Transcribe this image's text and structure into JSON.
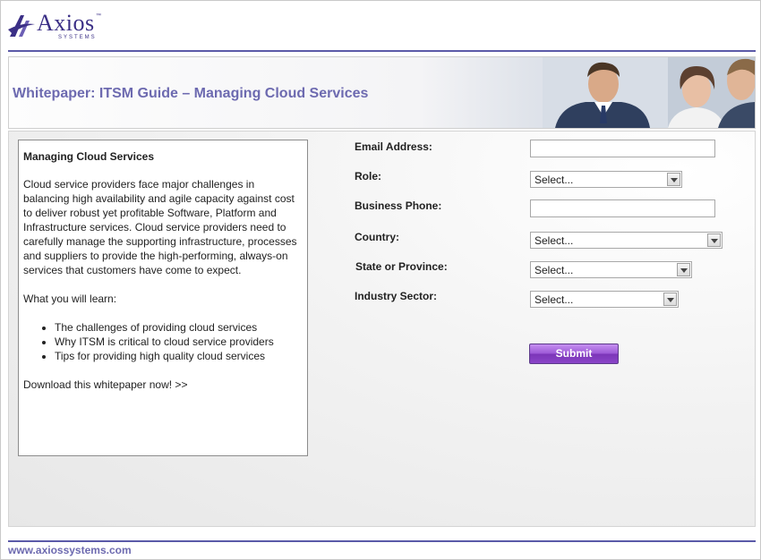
{
  "logo": {
    "name": "Axios",
    "tm": "™",
    "sub": "SYSTEMS"
  },
  "banner": {
    "title": "Whitepaper: ITSM Guide – Managing Cloud Services"
  },
  "info": {
    "heading": "Managing Cloud Services",
    "paragraph": "Cloud service providers face major challenges in balancing high availability and agile capacity against cost to deliver robust yet profitable Software, Platform and Infrastructure services. Cloud service providers need to carefully manage the supporting infrastructure, processes and suppliers to provide the high-performing, always-on services that customers have come to expect.",
    "learn": "What you will learn:",
    "items": [
      "The challenges of providing cloud services",
      "Why ITSM is critical to cloud service providers",
      "Tips for providing high quality cloud services"
    ],
    "cta": "Download this whitepaper now! >>"
  },
  "form": {
    "email_label": "Email Address:",
    "email_value": "",
    "role_label": "Role:",
    "role_value": "Select...",
    "phone_label": "Business Phone:",
    "phone_value": "",
    "country_label": "Country:",
    "country_value": "Select...",
    "state_label": "State or Province:",
    "state_value": "Select...",
    "industry_label": "Industry Sector:",
    "industry_value": "Select...",
    "submit_label": "Submit"
  },
  "footer": {
    "link": "www.axiossystems.com"
  }
}
